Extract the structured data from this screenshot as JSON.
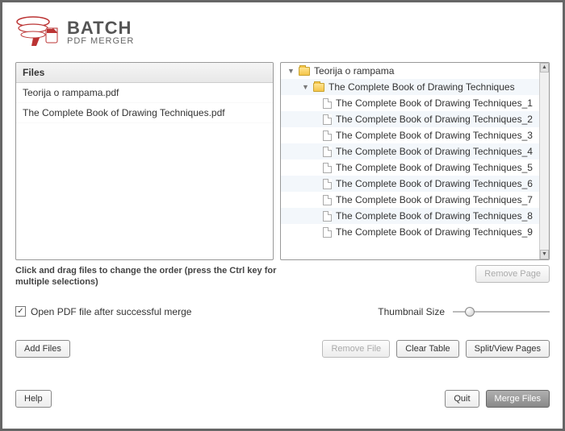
{
  "app": {
    "title_main": "BATCH",
    "title_sub": "PDF MERGER"
  },
  "left_panel": {
    "header": "Files",
    "files": [
      "Teorija o rampama.pdf",
      "The Complete Book of Drawing Techniques.pdf"
    ]
  },
  "tree": {
    "folders": [
      {
        "name": "Teorija o rampama",
        "pages": []
      },
      {
        "name": "The Complete Book of Drawing Techniques",
        "pages": [
          "The Complete Book of Drawing Techniques_1",
          "The Complete Book of Drawing Techniques_2",
          "The Complete Book of Drawing Techniques_3",
          "The Complete Book of Drawing Techniques_4",
          "The Complete Book of Drawing Techniques_5",
          "The Complete Book of Drawing Techniques_6",
          "The Complete Book of Drawing Techniques_7",
          "The Complete Book of Drawing Techniques_8",
          "The Complete Book of Drawing Techniques_9"
        ]
      }
    ]
  },
  "hint": "Click and drag files to change the order (press the Ctrl key for multiple selections)",
  "buttons": {
    "remove_page": "Remove Page",
    "add_files": "Add Files",
    "remove_file": "Remove File",
    "clear_table": "Clear Table",
    "split_view": "Split/View Pages",
    "help": "Help",
    "quit": "Quit",
    "merge": "Merge Files"
  },
  "checkbox": {
    "label": "Open PDF file after successful merge",
    "checked": true
  },
  "thumbnail": {
    "label": "Thumbnail Size"
  }
}
